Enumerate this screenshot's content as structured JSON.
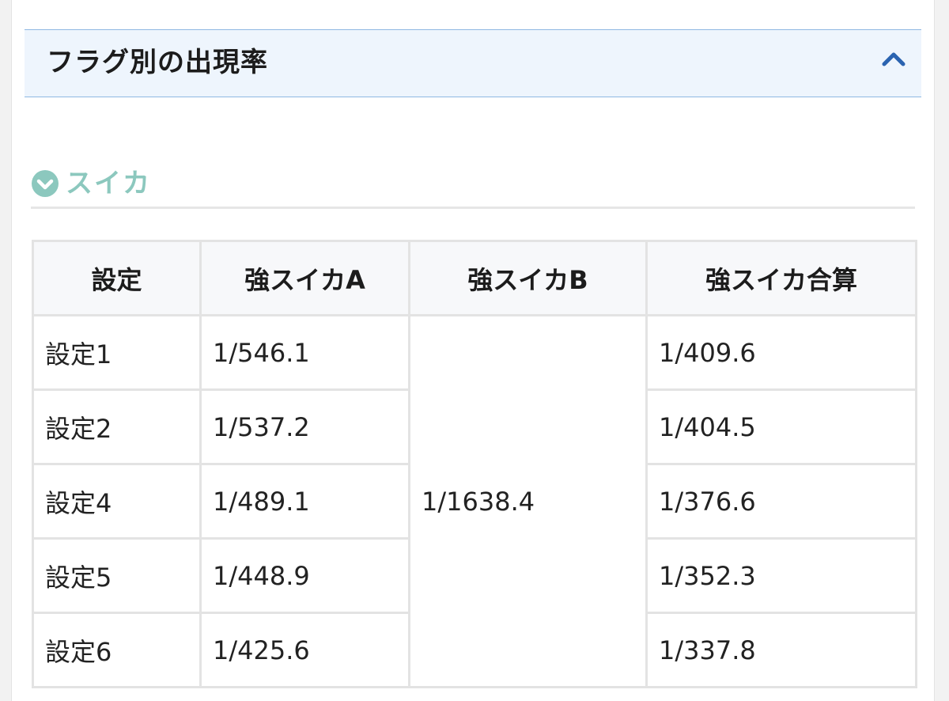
{
  "accordion": {
    "title": "フラグ別の出現率",
    "expanded": true,
    "toggle_icon": "chevron-up-icon",
    "accent_color": "#2a63b0"
  },
  "section": {
    "heading": "スイカ",
    "icon": "circle-chevron-down-icon",
    "heading_color": "#8cc8be"
  },
  "table": {
    "headers": [
      "設定",
      "強スイカA",
      "強スイカB",
      "強スイカ合算"
    ],
    "shared_b_value": "1/1638.4",
    "rows": [
      {
        "setting": "設定1",
        "a": "1/546.1",
        "total": "1/409.6"
      },
      {
        "setting": "設定2",
        "a": "1/537.2",
        "total": "1/404.5"
      },
      {
        "setting": "設定4",
        "a": "1/489.1",
        "total": "1/376.6"
      },
      {
        "setting": "設定5",
        "a": "1/448.9",
        "total": "1/352.3"
      },
      {
        "setting": "設定6",
        "a": "1/425.6",
        "total": "1/337.8"
      }
    ]
  }
}
